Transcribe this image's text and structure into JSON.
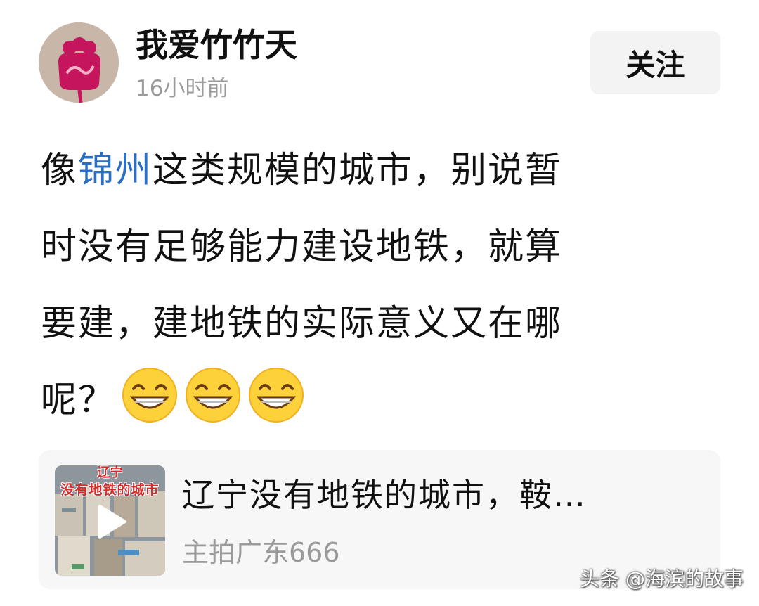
{
  "author": {
    "name": "我爱竹竹天",
    "time": "16小时前",
    "avatar_icon": "flower-logo-icon"
  },
  "follow": {
    "label": "关注"
  },
  "post": {
    "line1_prefix": "像",
    "line1_tag": "锦州",
    "line1_rest": "这类规模的城市，别说暂",
    "line2": "时没有足够能力建设地铁，就算",
    "line3": "要建，建地铁的实际意义又在哪",
    "line4": "呢？",
    "emoji_icon": "grinning-face-icon",
    "emoji_count": 3,
    "tag_color": "#2b6fc4"
  },
  "video": {
    "thumb_caption_top": "辽宁",
    "thumb_caption": "没有地铁的城市",
    "title": "辽宁没有地铁的城市，鞍…",
    "author": "主拍广东666",
    "play_icon": "play-icon"
  },
  "watermark": "头条 @海滨的故事"
}
